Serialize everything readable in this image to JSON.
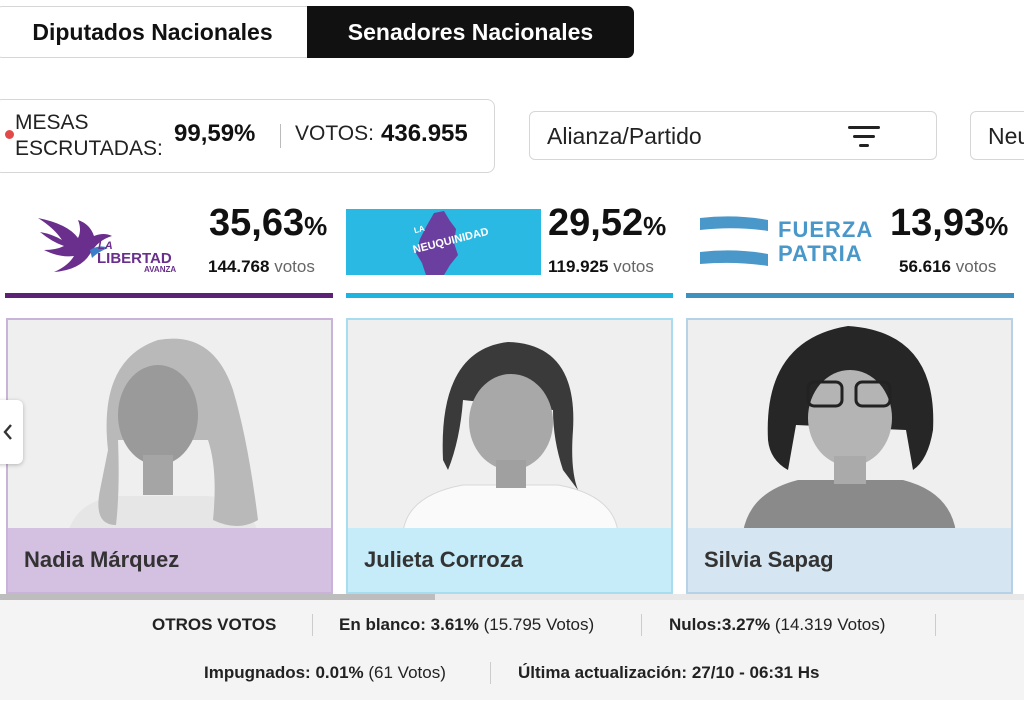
{
  "tabs": [
    {
      "label": "Diputados Nacionales",
      "active": false
    },
    {
      "label": "Senadores Nacionales",
      "active": true
    }
  ],
  "stats": {
    "mesas_label_1": "MESAS",
    "mesas_label_2": "ESCRUTADAS:",
    "mesas_value": "99,59%",
    "votos_label": "VOTOS:",
    "votos_value": "436.955"
  },
  "filter": {
    "label": "Alianza/Partido"
  },
  "province": {
    "label": "Neu"
  },
  "parties": [
    {
      "logo": "la-libertad-avanza-logo",
      "logo_text_1": "LA",
      "logo_text_2": "LIBERTAD",
      "logo_text_3": "AVANZA",
      "pct": "35,63",
      "pct_symbol": "%",
      "votes": "144.768",
      "votes_label": "votos",
      "color": "#5b2275",
      "candidate": "Nadia Márquez",
      "band_color": "#d4c0e0"
    },
    {
      "logo": "la-neuquinidad-logo",
      "logo_text_1": "LA",
      "logo_text_2": "NEUQUINIDAD",
      "pct": "29,52",
      "pct_symbol": "%",
      "votes": "119.925",
      "votes_label": "votos",
      "color": "#1fb3e0",
      "candidate": "Julieta Corroza",
      "band_color": "#c6ecfa"
    },
    {
      "logo": "fuerza-patria-logo",
      "logo_text_1": "FUERZA",
      "logo_text_2": "PATRIA",
      "pct": "13,93",
      "pct_symbol": "%",
      "votes": "56.616",
      "votes_label": "votos",
      "color": "#3f8fbf",
      "candidate": "Silvia Sapag",
      "band_color": "#d5e6f2"
    }
  ],
  "footer": {
    "otros": "OTROS VOTOS",
    "blanco_label": "En blanco:",
    "blanco_pct": "3.61%",
    "blanco_votes": "(15.795 Votos)",
    "nulos_label": "Nulos:",
    "nulos_pct": "3.27%",
    "nulos_votes": "(14.319 Votos)",
    "impugnados_label": "Impugnados:",
    "impugnados_pct": "0.01%",
    "impugnados_votes": "(61 Votos)",
    "update_label": "Última actualización:",
    "update_value": "27/10 - 06:31 Hs"
  }
}
